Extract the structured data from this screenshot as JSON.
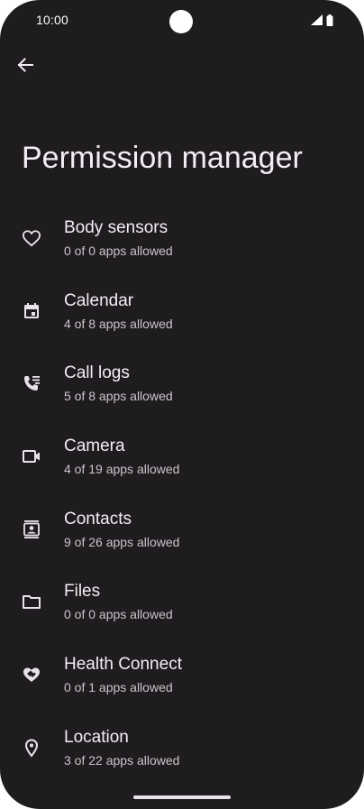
{
  "status_bar": {
    "time": "10:00"
  },
  "page": {
    "title": "Permission manager"
  },
  "permissions": [
    {
      "label": "Body sensors",
      "summary": "0 of 0 apps allowed",
      "icon": "heart-icon"
    },
    {
      "label": "Calendar",
      "summary": "4 of 8 apps allowed",
      "icon": "calendar-icon"
    },
    {
      "label": "Call logs",
      "summary": "5 of 8 apps allowed",
      "icon": "call-log-icon"
    },
    {
      "label": "Camera",
      "summary": "4 of 19 apps allowed",
      "icon": "camera-icon"
    },
    {
      "label": "Contacts",
      "summary": "9 of 26 apps allowed",
      "icon": "contacts-icon"
    },
    {
      "label": "Files",
      "summary": "0 of 0 apps allowed",
      "icon": "folder-icon"
    },
    {
      "label": "Health Connect",
      "summary": "0 of 1 apps allowed",
      "icon": "health-connect-icon"
    },
    {
      "label": "Location",
      "summary": "3 of 22 apps allowed",
      "icon": "location-pin-icon"
    }
  ],
  "colors": {
    "background": "#1f1c1f",
    "text_primary": "#f2edf2",
    "text_secondary": "#c9c4c9"
  }
}
